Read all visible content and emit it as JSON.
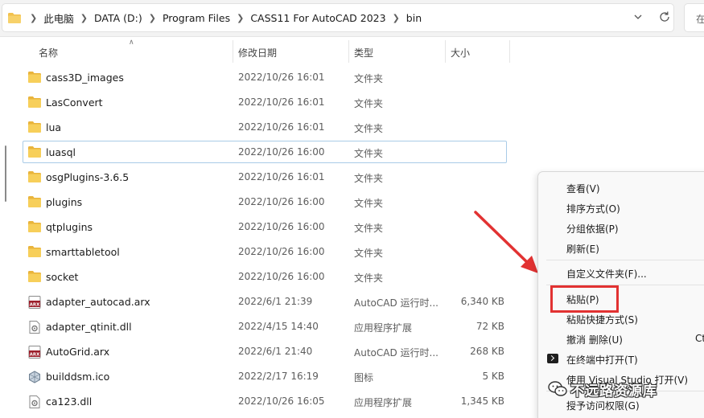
{
  "address_bar": {
    "crumbs": [
      "此电脑",
      "DATA (D:)",
      "Program Files",
      "CASS11 For AutoCAD 2023",
      "bin"
    ],
    "search_text": "在"
  },
  "columns": {
    "name": "名称",
    "date": "修改日期",
    "type": "类型",
    "size": "大小"
  },
  "rows": [
    {
      "icon": "folder-icon",
      "name": "cass3D_images",
      "date": "2022/10/26 16:01",
      "type": "文件夹",
      "size": ""
    },
    {
      "icon": "folder-icon",
      "name": "LasConvert",
      "date": "2022/10/26 16:01",
      "type": "文件夹",
      "size": ""
    },
    {
      "icon": "folder-icon",
      "name": "lua",
      "date": "2022/10/26 16:01",
      "type": "文件夹",
      "size": ""
    },
    {
      "icon": "folder-icon",
      "name": "luasql",
      "date": "2022/10/26 16:00",
      "type": "文件夹",
      "size": "",
      "selected": true
    },
    {
      "icon": "folder-icon",
      "name": "osgPlugins-3.6.5",
      "date": "2022/10/26 16:01",
      "type": "文件夹",
      "size": ""
    },
    {
      "icon": "folder-icon",
      "name": "plugins",
      "date": "2022/10/26 16:00",
      "type": "文件夹",
      "size": ""
    },
    {
      "icon": "folder-icon",
      "name": "qtplugins",
      "date": "2022/10/26 16:00",
      "type": "文件夹",
      "size": ""
    },
    {
      "icon": "folder-icon",
      "name": "smarttabletool",
      "date": "2022/10/26 16:00",
      "type": "文件夹",
      "size": ""
    },
    {
      "icon": "folder-icon",
      "name": "socket",
      "date": "2022/10/26 16:00",
      "type": "文件夹",
      "size": ""
    },
    {
      "icon": "arx-file-icon",
      "name": "adapter_autocad.arx",
      "date": "2022/6/1 21:39",
      "type": "AutoCAD 运行时...",
      "size": "6,340 KB"
    },
    {
      "icon": "dll-file-icon",
      "name": "adapter_qtinit.dll",
      "date": "2022/4/15 14:40",
      "type": "应用程序扩展",
      "size": "72 KB"
    },
    {
      "icon": "arx-file-icon",
      "name": "AutoGrid.arx",
      "date": "2022/6/1 21:40",
      "type": "AutoCAD 运行时...",
      "size": "268 KB"
    },
    {
      "icon": "ico-file-icon",
      "name": "builddsm.ico",
      "date": "2022/2/17 16:19",
      "type": "图标",
      "size": "5 KB"
    },
    {
      "icon": "dll-file-icon",
      "name": "ca123.dll",
      "date": "2022/10/26 16:05",
      "type": "应用程序扩展",
      "size": "1,345 KB"
    }
  ],
  "context_menu": {
    "view": "查看(V)",
    "sort": "排序方式(O)",
    "group": "分组依据(P)",
    "refresh": "刷新(E)",
    "customize": "自定义文件夹(F)...",
    "paste": "粘贴(P)",
    "paste_shortcut": "粘贴快捷方式(S)",
    "undo_delete": "撤消 删除(U)",
    "undo_shortcut": "Ct",
    "open_terminal": "在终端中打开(T)",
    "open_vs": "使用 Visual Studio 打开(V)",
    "access": "授予访问权限(G)"
  },
  "watermark": {
    "text": "不远路资源库"
  },
  "colors": {
    "highlight_box": "#e23232",
    "arrow": "#e23232",
    "folder": "#f2c14e",
    "selected_border": "#a9cbe7"
  }
}
